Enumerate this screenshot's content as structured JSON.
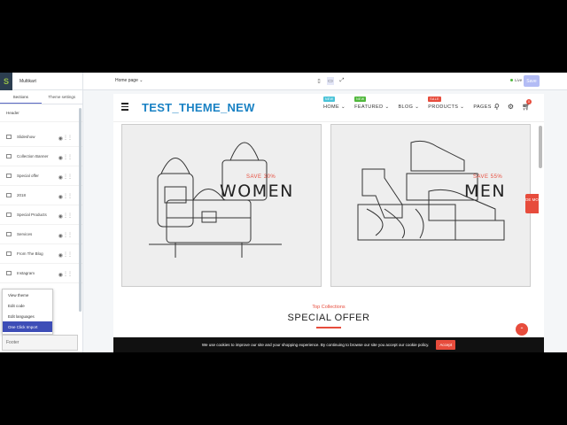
{
  "sidebar": {
    "store_name": "Multikart",
    "tabs": [
      "Sections",
      "Theme settings"
    ],
    "sections": [
      {
        "label": "Header"
      },
      {
        "label": "Slideshow"
      },
      {
        "label": "Collection Banner"
      },
      {
        "label": "Special offer"
      },
      {
        "label": "2018"
      },
      {
        "label": "Special Products"
      },
      {
        "label": "Services"
      },
      {
        "label": "From The Blog"
      },
      {
        "label": "Instagram"
      }
    ],
    "menu": [
      "View theme",
      "Edit code",
      "Edit languages",
      "One Click Import"
    ],
    "bottom_label": "Footer"
  },
  "topbar": {
    "page_select": "Home page",
    "status": "Live",
    "save_label": "Save"
  },
  "site": {
    "logo": "TEST_THEME_NEW",
    "nav": [
      {
        "label": "HOME",
        "badge": "NEW",
        "badge_color": "#4ac3d8"
      },
      {
        "label": "FEATURED",
        "badge": "NEW",
        "badge_color": "#50b83c"
      },
      {
        "label": "BLOG",
        "badge": "",
        "badge_color": ""
      },
      {
        "label": "PRODUCTS",
        "badge": "SALE",
        "badge_color": "#e74c3c"
      },
      {
        "label": "PAGES",
        "badge": "",
        "badge_color": ""
      }
    ],
    "cart_count": "0",
    "banners": [
      {
        "save": "SAVE 30%",
        "title": "WOMEN"
      },
      {
        "save": "SAVE 55%",
        "title": "MEN"
      }
    ],
    "demo_label": "DE MO",
    "section_sub": "Top Collections",
    "section_title": "SPECIAL OFFER",
    "cookie_text": "We use cookies to improve our site and your shopping experience. By continuing to browse our site you accept our cookie policy.",
    "cookie_accept": "Accept"
  },
  "colors": {
    "accent": "#e74c3c",
    "logo": "#1a82c4",
    "menu_selected": "#3d4db7"
  }
}
